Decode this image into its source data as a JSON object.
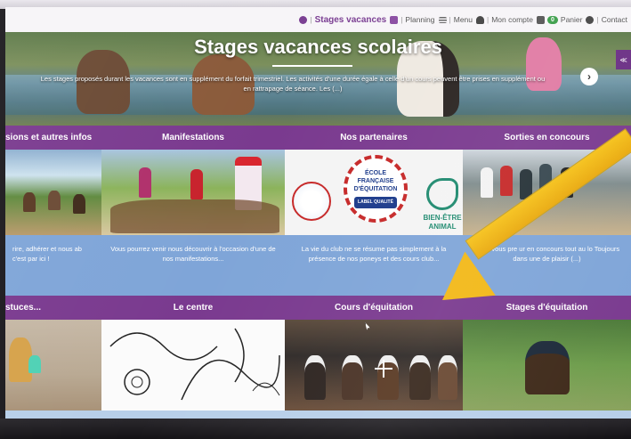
{
  "topnav": {
    "stages": "Stages vacances",
    "planning": "Planning",
    "menu": "Menu",
    "account": "Mon compte",
    "cart_count": "0",
    "cart": "Panier",
    "contact": "Contact"
  },
  "hero": {
    "title": "Stages vacances scolaires",
    "description": "Les stages proposés durant les vacances sont en supplément du forfait trimestriel. Les activités d'une durée égale à celle d'un cours peuvent être prises en supplément ou en rattrapage de séance. Les (...)",
    "next_glyph": "›",
    "side_tab_glyph": "≪"
  },
  "tiles_row1": [
    {
      "title": "sions et autres infos",
      "text": "rire, adhérer et nous ab c'est par ici !"
    },
    {
      "title": "Manifestations",
      "text": "Vous pourrez venir nous découvrir à l'occasion d'une de nos manifestations..."
    },
    {
      "title": "Nos partenaires",
      "text": "La vie du club ne se résume pas simplement à la présence de nos poneys et des cours club..."
    },
    {
      "title": "Sorties en concours",
      "text": "Nous vous pre      ur en concours tout au lo         Toujours dans une         de plaisir (...)"
    }
  ],
  "tiles_row2": [
    {
      "title": "stuces..."
    },
    {
      "title": "Le centre"
    },
    {
      "title": "Cours d'équitation"
    },
    {
      "title": "Stages d'équitation"
    }
  ],
  "partner_logos": {
    "ffe_line1": "ÉCOLE",
    "ffe_line2": "FRANÇAISE",
    "ffe_line3": "D'ÉQUITATION",
    "ffe_label": "LABEL QUALITÉ",
    "bien_line1": "BIEN-ÊTRE",
    "bien_line2": "ANIMAL"
  },
  "colors": {
    "tile_header": "#7a3a8f",
    "tile_text_bg": "#7fa5d8",
    "accent": "#7b3f93",
    "arrow": "#f2b817"
  }
}
